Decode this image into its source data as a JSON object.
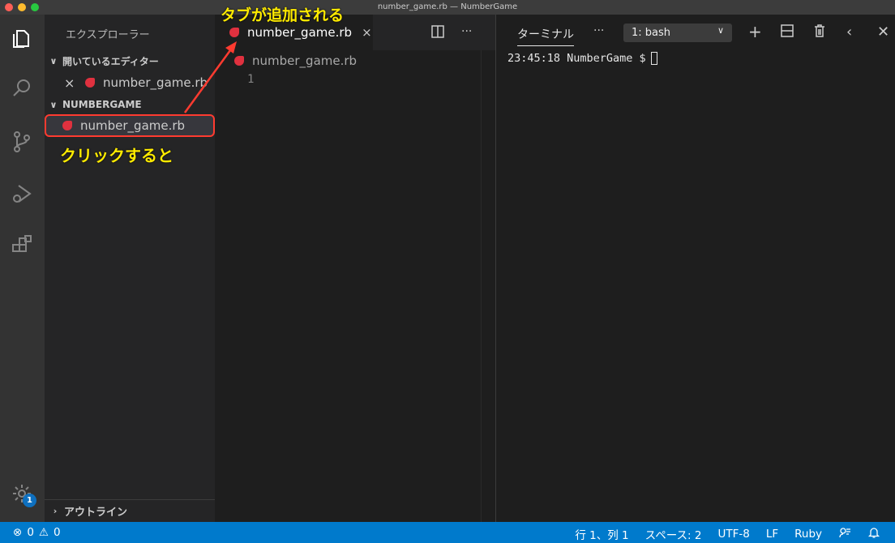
{
  "window": {
    "title": "number_game.rb — NumberGame"
  },
  "activity_bar": {
    "items": [
      {
        "name": "explorer-icon"
      },
      {
        "name": "search-icon"
      },
      {
        "name": "source-control-icon"
      },
      {
        "name": "run-debug-icon"
      },
      {
        "name": "extensions-icon"
      }
    ],
    "settings_badge": "1"
  },
  "sidebar": {
    "title": "エクスプローラー",
    "open_editors": {
      "label": "開いているエディター",
      "items": [
        {
          "close_glyph": "×",
          "filename": "number_game.rb"
        }
      ]
    },
    "folder": {
      "label": "NUMBERGAME",
      "items": [
        {
          "filename": "number_game.rb"
        }
      ]
    },
    "outline_label": "アウトライン"
  },
  "annotations": {
    "click_note": "クリックすると",
    "tab_note": "タブが追加される",
    "color": "#ffeb00",
    "highlight_color": "#ff3b30"
  },
  "editor": {
    "tab": {
      "filename": "number_game.rb",
      "close_glyph": "×"
    },
    "actions": {
      "split_icon": "split-editor-icon",
      "more": "···"
    },
    "breadcrumb": "number_game.rb",
    "line_number": "1"
  },
  "terminal": {
    "tab_label": "ターミナル",
    "more": "···",
    "selected_shell": "1: bash",
    "prompt": "23:45:18 NumberGame $",
    "icons": [
      "plus-icon",
      "split-terminal-icon",
      "trash-icon",
      "chevron-left-icon",
      "close-icon"
    ]
  },
  "status_bar": {
    "errors": "0",
    "warnings": "0",
    "position": "行 1、列 1",
    "indent": "スペース: 2",
    "encoding": "UTF-8",
    "eol": "LF",
    "language": "Ruby",
    "accent": "#007acc"
  }
}
